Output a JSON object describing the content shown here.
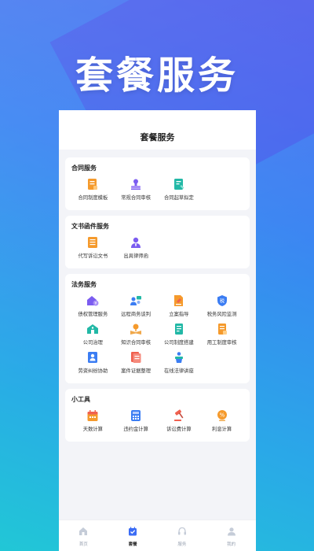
{
  "headline": "套餐服务",
  "nav": {
    "title": "套餐服务"
  },
  "sections": [
    {
      "title": "合同服务",
      "items": [
        {
          "label": "合同制度模板",
          "icon": "document-icon"
        },
        {
          "label": "常规合同审核",
          "icon": "stamp-icon"
        },
        {
          "label": "合同起草拟定",
          "icon": "contract-draft-icon"
        }
      ]
    },
    {
      "title": "文书函件服务",
      "items": [
        {
          "label": "代写诉讼文书",
          "icon": "list-document-icon"
        },
        {
          "label": "出具律师函",
          "icon": "lawyer-icon"
        }
      ]
    },
    {
      "title": "法务服务",
      "items": [
        {
          "label": "债权管理服务",
          "icon": "debt-icon"
        },
        {
          "label": "远程商务谈判",
          "icon": "meeting-icon"
        },
        {
          "label": "立案指导",
          "icon": "filing-icon"
        },
        {
          "label": "税务风险监测",
          "icon": "tax-shield-icon"
        },
        {
          "label": "公司治理",
          "icon": "company-icon"
        },
        {
          "label": "知识合同审核",
          "icon": "knowledge-icon"
        },
        {
          "label": "公司制度搭建",
          "icon": "policy-icon"
        },
        {
          "label": "用工制度审核",
          "icon": "employment-icon"
        },
        {
          "label": "劳资纠纷协助",
          "icon": "labor-icon"
        },
        {
          "label": "案件证据整理",
          "icon": "evidence-icon"
        },
        {
          "label": "在线法律讲座",
          "icon": "lecture-icon"
        }
      ]
    },
    {
      "title": "小工具",
      "items": [
        {
          "label": "天数计算",
          "icon": "calendar-icon"
        },
        {
          "label": "违约金计算",
          "icon": "calculator-icon"
        },
        {
          "label": "诉讼费计算",
          "icon": "gavel-icon"
        },
        {
          "label": "利息计算",
          "icon": "interest-icon"
        }
      ]
    }
  ],
  "tabbar": [
    {
      "label": "首页",
      "icon": "home-icon",
      "active": false
    },
    {
      "label": "套餐",
      "icon": "package-icon",
      "active": true
    },
    {
      "label": "服务",
      "icon": "headset-icon",
      "active": false
    },
    {
      "label": "我的",
      "icon": "user-icon",
      "active": false
    }
  ],
  "colors": {
    "orange": "#f59a2c",
    "purple": "#7b5cf0",
    "teal": "#22b8a6",
    "blue": "#3b7df3",
    "red": "#f0604f",
    "tab_inactive": "#c5ccd8",
    "tab_active": "#3b6cf5"
  }
}
